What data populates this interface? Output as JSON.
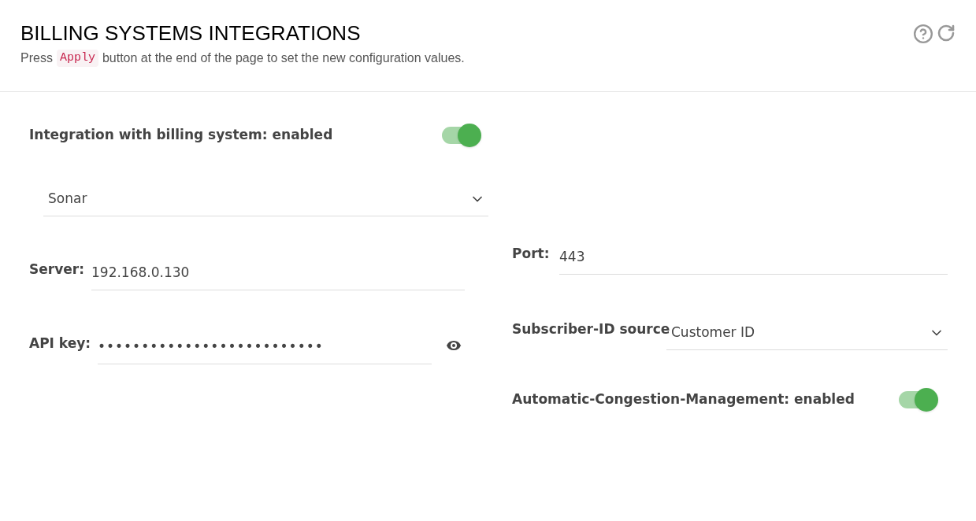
{
  "header": {
    "title": "BILLING SYSTEMS INTEGRATIONS",
    "subtitle_prefix": "Press",
    "subtitle_code": "Apply",
    "subtitle_suffix": "button at the end of the page to set the new configuration values."
  },
  "integration": {
    "label": "Integration with billing system: enabled",
    "on": true
  },
  "billing_system": {
    "value": "Sonar"
  },
  "server": {
    "label": "Server:",
    "value": "192.168.0.130"
  },
  "port": {
    "label": "Port:",
    "value": "443"
  },
  "api_key": {
    "label": "API key:",
    "value": "••••••••••••••••••••••••••"
  },
  "subscriber_id_source": {
    "label": "Subscriber-ID source",
    "value": "Customer ID"
  },
  "congestion": {
    "label": "Automatic-Congestion-Management: enabled",
    "on": true
  }
}
